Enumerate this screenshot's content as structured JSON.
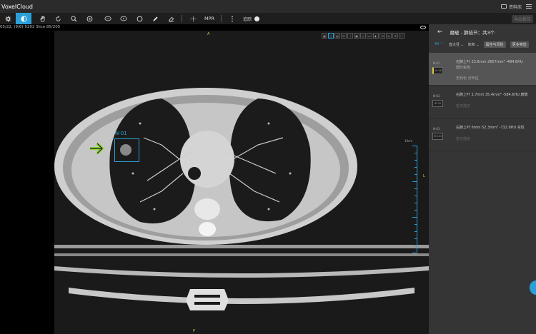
{
  "app": {
    "title": "VoxelCloud",
    "library_label": "资料库"
  },
  "toolbar": {
    "mpr_label": "MPR",
    "toggle_label": "追踪",
    "export_label": "导出报告"
  },
  "viewport": {
    "series_info": "05/22, (9/8)-5202 Slice 85/205",
    "orient_top": "A",
    "orient_bottom": "P",
    "orient_right": "L",
    "ruler_label": "10cm",
    "nodule_tag": "N-01",
    "arrow_color": "#8dd62f",
    "accent_color": "#2aa0d8"
  },
  "panel": {
    "back_label": "←",
    "title": "磨玻 - 肺结节：共3个",
    "filters": {
      "all": "All ⌃",
      "sort": "直大径 ⌄",
      "volume": "体积 ⌄",
      "risk": "属性与风险",
      "more": "更多筛选"
    },
    "items": [
      {
        "id": "N-01",
        "thumb": "IM 98",
        "line1": "右肺上叶  23.6mm  2657mm³  -494.6HU",
        "line2": "部分实性",
        "line3": "无钙化   分叶征",
        "selected": true
      },
      {
        "id": "N-02",
        "thumb": "IM 92",
        "line1": "右肺上叶  2.7mm  35.4mm³  -584.6HU  磨玻",
        "line2": "",
        "line3": "",
        "muted": "暂无描述",
        "selected": false
      },
      {
        "id": "N-03",
        "thumb": "IM 102",
        "line1": "右肺上叶  6mm  52.3mm³  -732.9HU  实性",
        "line2": "",
        "line3": "",
        "muted": "暂无描述",
        "selected": false
      }
    ]
  }
}
